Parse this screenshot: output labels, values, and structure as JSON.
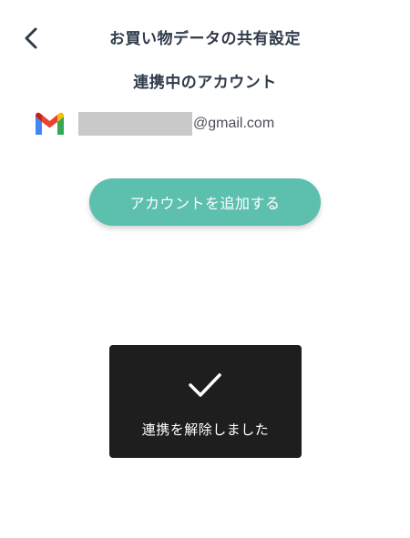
{
  "header": {
    "back_icon": "chevron-left-icon",
    "title": "お買い物データの共有設定"
  },
  "linked_accounts": {
    "section_title": "連携中のアカウント",
    "account": {
      "provider_icon": "gmail-icon",
      "email_domain": "@gmail.com"
    }
  },
  "add_account_button": {
    "label": "アカウントを追加する",
    "color": "#5dbfae"
  },
  "toast": {
    "icon": "checkmark-icon",
    "message": "連携を解除しました",
    "background": "#1e1e1e"
  }
}
